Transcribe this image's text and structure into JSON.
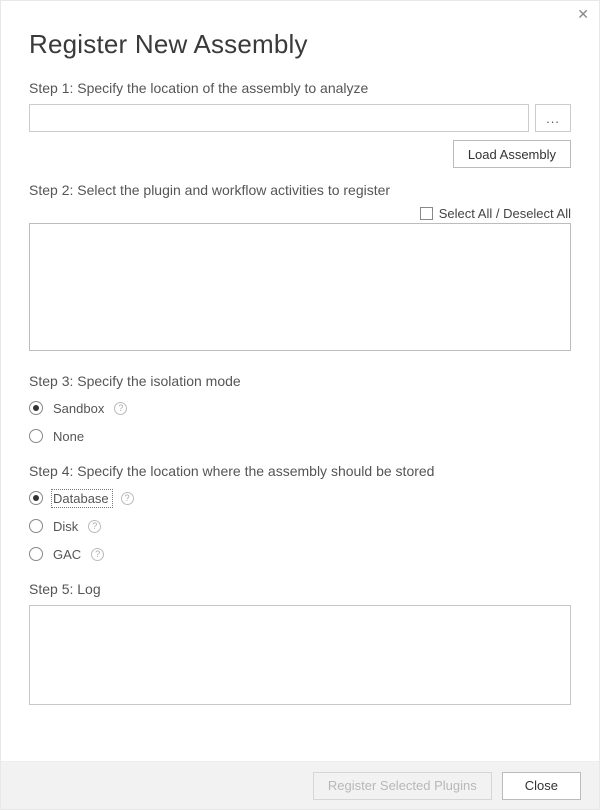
{
  "title": "Register New Assembly",
  "close_glyph": "✕",
  "step1": {
    "label": "Step 1: Specify the location of the assembly to analyze",
    "path_value": "",
    "browse_label": "...",
    "load_label": "Load Assembly"
  },
  "step2": {
    "label": "Step 2: Select the plugin and workflow activities to register",
    "select_all_label": "Select All / Deselect All",
    "select_all_checked": false,
    "items": []
  },
  "step3": {
    "label": "Step 3: Specify the isolation mode",
    "options": [
      {
        "label": "Sandbox",
        "selected": true,
        "help": true
      },
      {
        "label": "None",
        "selected": false,
        "help": false
      }
    ]
  },
  "step4": {
    "label": "Step 4: Specify the location where the assembly should be stored",
    "options": [
      {
        "label": "Database",
        "selected": true,
        "help": true,
        "focused": true
      },
      {
        "label": "Disk",
        "selected": false,
        "help": true,
        "focused": false
      },
      {
        "label": "GAC",
        "selected": false,
        "help": true,
        "focused": false
      }
    ]
  },
  "step5": {
    "label": "Step 5: Log",
    "log_text": ""
  },
  "footer": {
    "register_label": "Register Selected Plugins",
    "register_enabled": false,
    "close_label": "Close"
  },
  "help_glyph": "?"
}
